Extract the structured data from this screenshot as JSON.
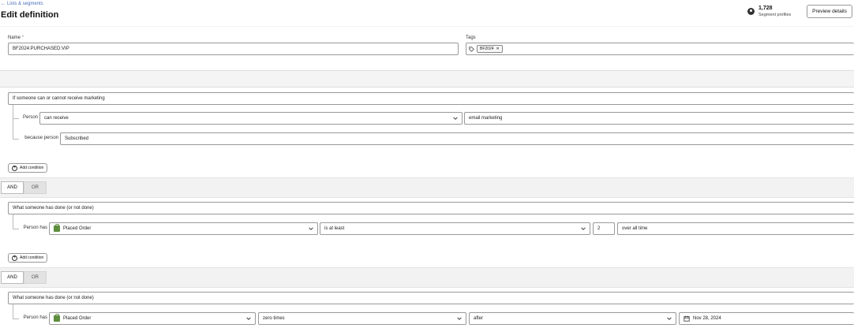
{
  "header": {
    "back_label": "Lists & segments",
    "title": "Edit definition",
    "profiles_count": "1,728",
    "profiles_label": "Segment profiles",
    "preview_label": "Preview details"
  },
  "form": {
    "name_label": "Name",
    "name_required_mark": "*",
    "name_value": "BF2024:PURCHASED:VIP",
    "tags_label": "Tags",
    "tags": [
      "BF2024"
    ]
  },
  "groups": [
    {
      "header": "If someone can or cannot receive marketing",
      "rows": [
        {
          "label": "Person",
          "select1": "can receive",
          "select2": "email marketing"
        },
        {
          "label": "because person",
          "value": "Subscribed"
        }
      ],
      "add_label": "Add condition"
    },
    {
      "header": "What someone has done (or not done)",
      "rows": [
        {
          "label": "Person has",
          "metric": "Placed Order",
          "operator": "is at least",
          "count": "2",
          "timeframe": "over all time"
        }
      ],
      "add_label": "Add condition"
    },
    {
      "header": "What someone has done (or not done)",
      "rows": [
        {
          "label": "Person has",
          "metric": "Placed Order",
          "operator": "zero times",
          "time_operator": "after",
          "date": "Nov 28, 2024"
        }
      ]
    }
  ],
  "logic": [
    {
      "and_label": "AND",
      "or_label": "OR"
    },
    {
      "and_label": "AND",
      "or_label": "OR"
    }
  ],
  "colors": {
    "link": "#4a6fb5",
    "shopify_green": "#5e8e3e"
  }
}
